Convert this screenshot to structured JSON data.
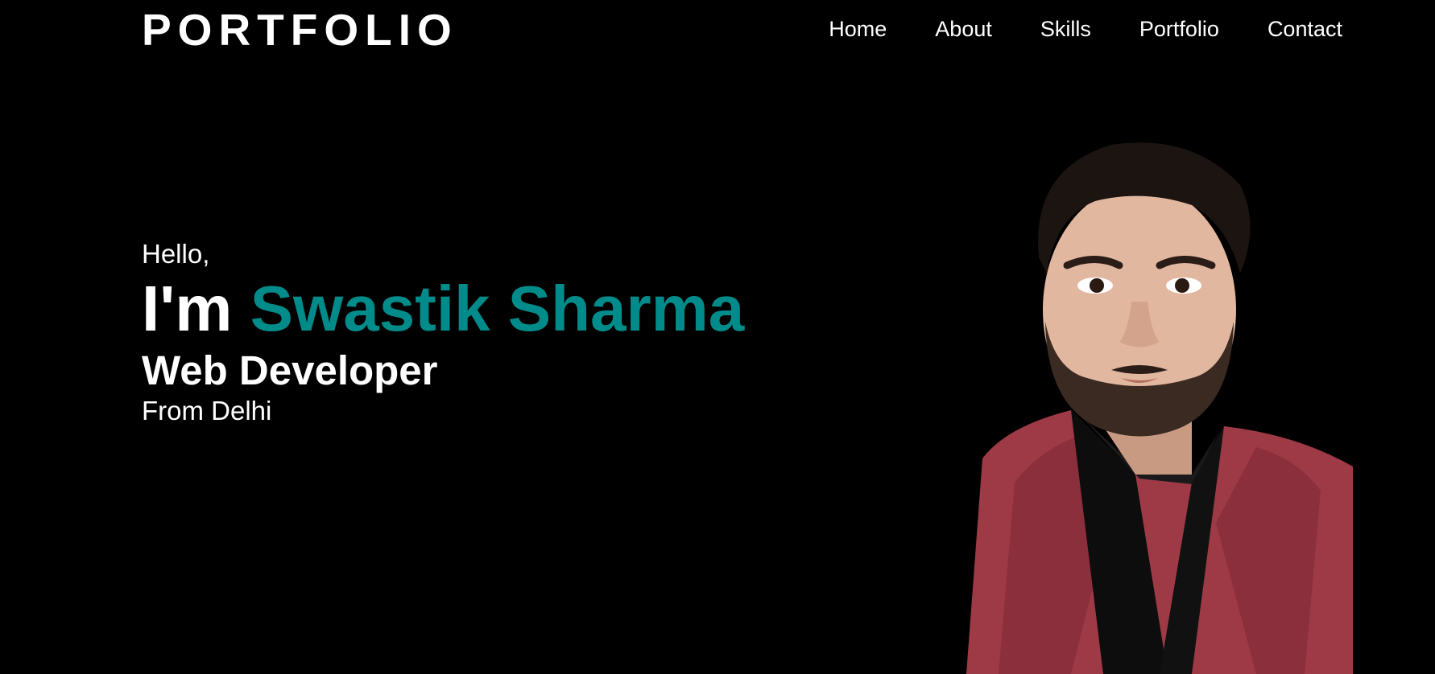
{
  "navbar": {
    "brand": "PORTFOLIO",
    "links": [
      "Home",
      "About",
      "Skills",
      "Portfolio",
      "Contact"
    ]
  },
  "hero": {
    "greeting": "Hello,",
    "intro_prefix": "I'm",
    "name": "Swastik Sharma",
    "role": "Web Developer",
    "location": "From Delhi"
  },
  "colors": {
    "background": "#000000",
    "text": "#ffffff",
    "accent": "#008b8b",
    "jacket": "#9e3a46"
  }
}
